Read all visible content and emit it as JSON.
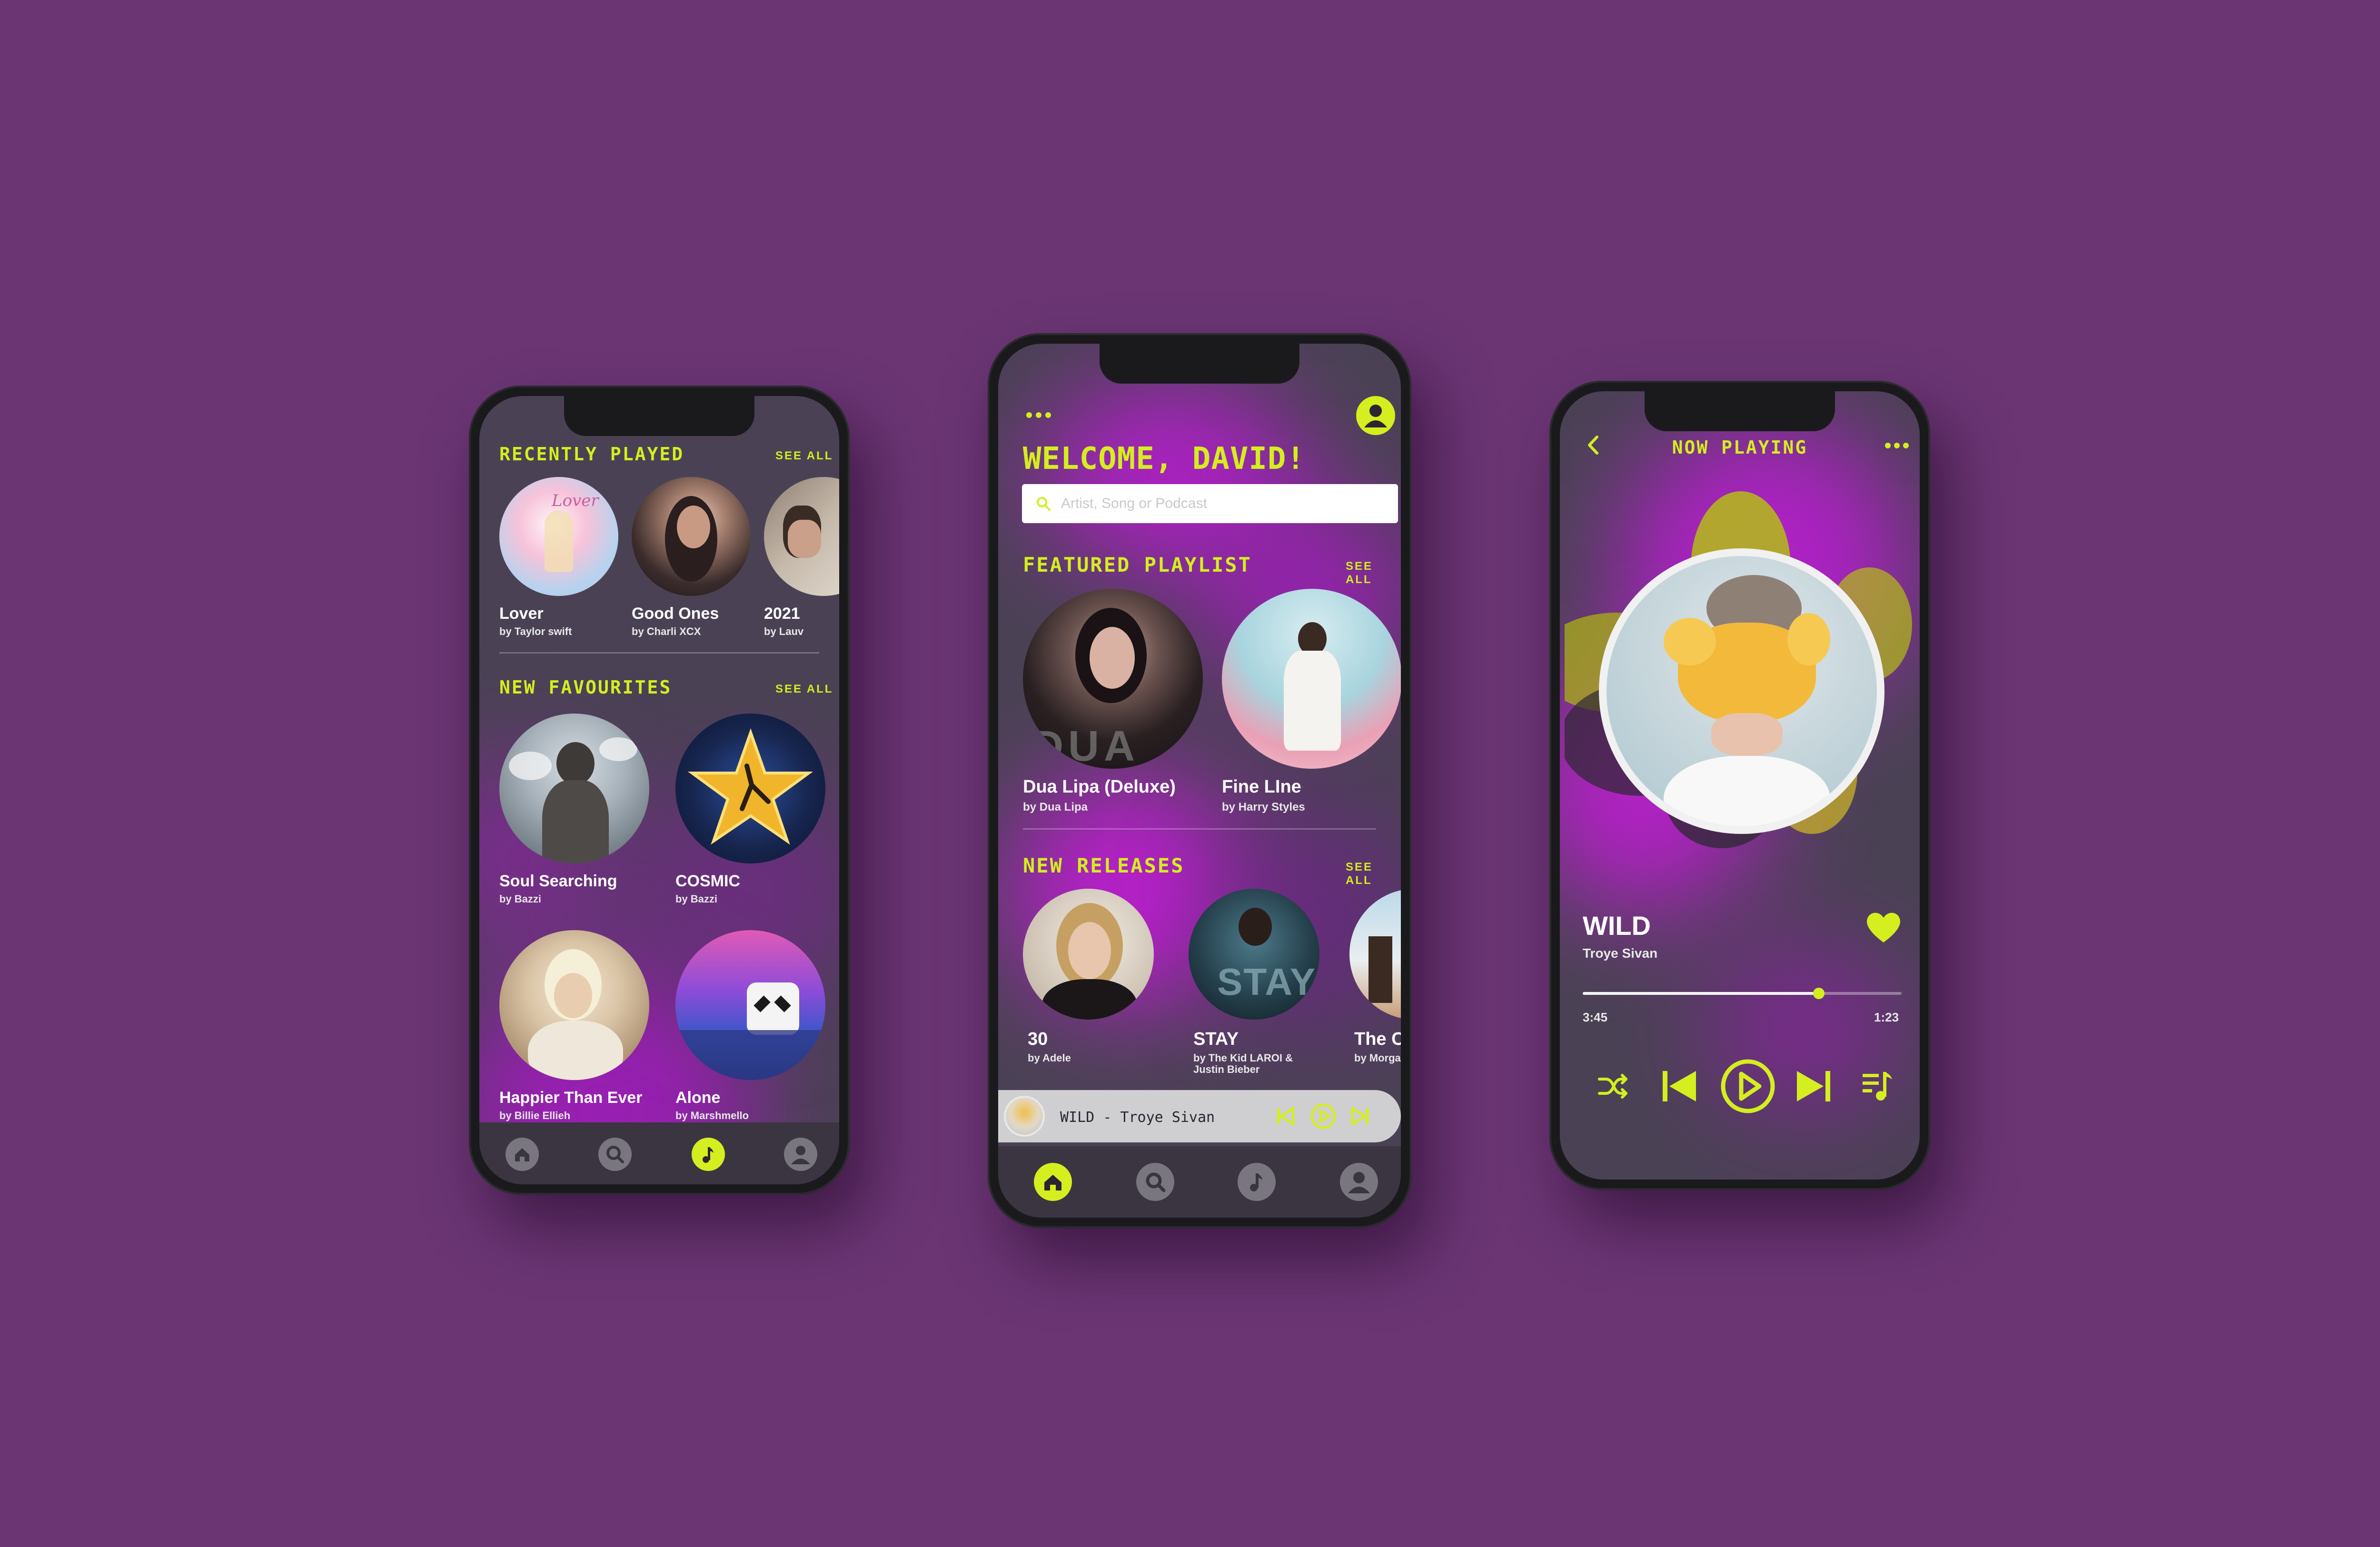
{
  "colors": {
    "background": "#6b3574",
    "accent": "#d4ee1f",
    "screen": "#4a4254",
    "glow": "#b417d2"
  },
  "phone_left": {
    "recently_played": {
      "heading": "RECENTLY PLAYED",
      "see_all": "SEE ALL",
      "items": [
        {
          "title": "Lover",
          "artist": "by Taylor swift"
        },
        {
          "title": "Good Ones",
          "artist": "by Charli XCX"
        },
        {
          "title": "2021",
          "artist": "by Lauv"
        }
      ]
    },
    "new_favourites": {
      "heading": "NEW FAVOURITES",
      "see_all": "SEE ALL",
      "items": [
        {
          "title": "Soul Searching",
          "artist": "by Bazzi"
        },
        {
          "title": "COSMIC",
          "artist": "by Bazzi"
        },
        {
          "title": "Happier Than Ever",
          "artist": "by Billie Ellieh"
        },
        {
          "title": "Alone",
          "artist": "by Marshmello"
        }
      ]
    },
    "nav": {
      "active": "music"
    }
  },
  "phone_center": {
    "greeting": "WELCOME, DAVID!",
    "search_placeholder": "Artist, Song or Podcast",
    "featured": {
      "heading": "FEATURED PLAYLIST",
      "see_all": "SEE ALL",
      "items": [
        {
          "title": "Dua Lipa (Deluxe)",
          "artist": "by Dua Lipa"
        },
        {
          "title": "Fine LIne",
          "artist": "by Harry Styles"
        }
      ]
    },
    "new_releases": {
      "heading": "NEW RELEASES",
      "see_all": "SEE ALL",
      "items": [
        {
          "title": "30",
          "artist": "by Adele",
          "artist2": ""
        },
        {
          "title": "STAY",
          "artist": "by The Kid LAROI &",
          "artist2": "Justin Bieber"
        },
        {
          "title": "The Co",
          "artist": "by Morgan",
          "artist2": ""
        }
      ]
    },
    "mini_player": {
      "track": "WILD - Troye Sivan"
    },
    "nav": {
      "active": "home"
    }
  },
  "phone_right": {
    "header": "NOW PLAYING",
    "track": "WILD",
    "artist": "Troye Sivan",
    "elapsed": "3:45",
    "remaining": "1:23",
    "progress": 0.74,
    "liked": true
  }
}
